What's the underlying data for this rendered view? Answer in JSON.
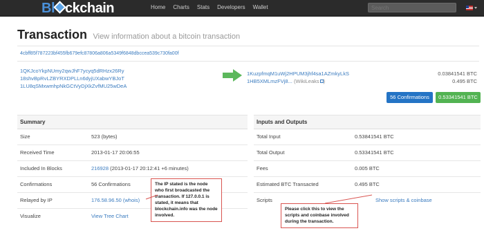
{
  "navbar": {
    "logo": {
      "part1": "Bl",
      "part2": "ckchain"
    },
    "links": [
      "Home",
      "Charts",
      "Stats",
      "Developers",
      "Wallet"
    ],
    "search_placeholder": "Search"
  },
  "heading": {
    "title": "Transaction",
    "subtitle": "View information about a bitcoin transaction"
  },
  "tx_hash": "4cbff85f787223bf455fb679efc87806a806a5349f6848dbccea539c730fa00f",
  "inputs": [
    "1QKJcoYkpNUmy2qwJhF7ycyq5dRHzx26Ry",
    "18shvBpRvLZBYRXDPLLn6dyjUXabwYBJoT",
    "1LU8qSMxwmhpNkGCtVyDjXkZvfMU25wDeA"
  ],
  "outputs": [
    {
      "address": "1KuzpfmqM1uWj2HPUM3jhf4sa1AZmkyLkS",
      "amount": "0.03841541 BTC",
      "tag": ""
    },
    {
      "address": "1HB5XMLmzFVj8...",
      "amount": "0.495 BTC",
      "tag": "(WikiLeaks"
    }
  ],
  "buttons": {
    "confirmations": "56 Confirmations",
    "total": "0.53341541 BTC"
  },
  "summary": {
    "header": "Summary",
    "rows": [
      {
        "label": "Size",
        "value": "523 (bytes)"
      },
      {
        "label": "Received Time",
        "value": "2013-01-17 20:06:55"
      },
      {
        "label": "Included In Blocks",
        "block": "216928",
        "value": "(2013-01-17 20:12:41 +6 minutes)"
      },
      {
        "label": "Confirmations",
        "value": "56 Confirmations"
      },
      {
        "label": "Relayed by IP",
        "ip": "176.58.96.50",
        "whois": "(whois)"
      },
      {
        "label": "Visualize",
        "value": "View Tree Chart"
      }
    ]
  },
  "io": {
    "header": "Inputs and Outputs",
    "rows": [
      {
        "label": "Total Input",
        "value": "0.53841541 BTC"
      },
      {
        "label": "Total Output",
        "value": "0.53341541 BTC"
      },
      {
        "label": "Fees",
        "value": "0.005 BTC"
      },
      {
        "label": "Estimated BTC Transacted",
        "value": "0.495 BTC"
      },
      {
        "label": "Scripts",
        "value": "Show scripts & coinbase"
      }
    ]
  },
  "annotations": {
    "ip_note": "The IP stated is the node who first broadcasted the transaction. If 127.0.0.1 is stated, it means that blockchain.info was the node involved.",
    "scripts_note": "Please click this to view the scripts and coinbase involved during the transaction."
  },
  "colors": {
    "navbar_bg": "#2b2b2b",
    "link": "#3a7bbf",
    "confirm_button": "#2474c5",
    "total_button": "#52b352",
    "arrow": "#5cb85c",
    "callout_border": "#d9534f"
  },
  "icons": [
    "blockchain-logo",
    "flag-uk-icon",
    "right-arrow-icon",
    "external-link-icon"
  ]
}
